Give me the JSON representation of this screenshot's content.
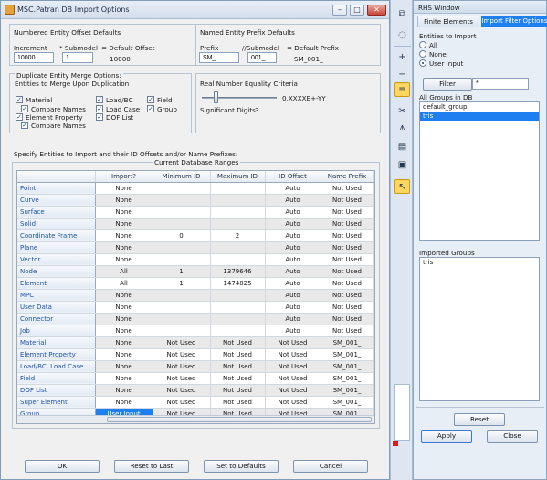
{
  "dialog": {
    "title": "MSC.Patran DB Import Options",
    "min": "–",
    "max": "□",
    "close": "✕"
  },
  "offsets": {
    "legend": "Numbered Entity Offset Defaults",
    "increment_label": "Increment",
    "submodel_label": "* Submodel",
    "default_label": "= Default Offset",
    "increment_value": "10000",
    "submodel_value": "1",
    "default_value": "10000"
  },
  "prefix": {
    "legend": "Named Entity Prefix Defaults",
    "prefix_label": "Prefix",
    "submodel_label": "//Submodel",
    "default_label": "= Default Prefix",
    "prefix_value": "SM_",
    "submodel_value": "001_",
    "default_value": "SM_001_"
  },
  "merge": {
    "legend_line1": "Duplicate Entity Merge Options:",
    "legend_line2": "Entities to Merge Upon Duplication",
    "items": {
      "material": "Material",
      "compare1": "Compare Names",
      "element_property": "Element Property",
      "compare2": "Compare Names",
      "load_bc": "Load/BC",
      "load_case": "Load Case",
      "dof_list": "DOF List",
      "field": "Field",
      "group": "Group"
    }
  },
  "equality": {
    "legend": "Real Number Equality Criteria",
    "format": "0.XXXXE+-YY",
    "digits_label": "Significant Digits",
    "digits_value": "3"
  },
  "table_section": {
    "heading": "Specify Entities to Import and their ID Offsets and/or Name Prefixes:",
    "subheading": "Current Database Ranges",
    "columns": [
      "Import?",
      "Minimum ID",
      "Maximum ID",
      "ID Offset",
      "Name Prefix"
    ],
    "rows": [
      {
        "name": "Point",
        "import": "None",
        "min": "",
        "max": "",
        "offset": "Auto",
        "prefix": "Not Used"
      },
      {
        "name": "Curve",
        "import": "None",
        "min": "",
        "max": "",
        "offset": "Auto",
        "prefix": "Not Used"
      },
      {
        "name": "Surface",
        "import": "None",
        "min": "",
        "max": "",
        "offset": "Auto",
        "prefix": "Not Used"
      },
      {
        "name": "Solid",
        "import": "None",
        "min": "",
        "max": "",
        "offset": "Auto",
        "prefix": "Not Used"
      },
      {
        "name": "Coordinate Frame",
        "import": "None",
        "min": "0",
        "max": "2",
        "offset": "Auto",
        "prefix": "Not Used"
      },
      {
        "name": "Plane",
        "import": "None",
        "min": "",
        "max": "",
        "offset": "Auto",
        "prefix": "Not Used"
      },
      {
        "name": "Vector",
        "import": "None",
        "min": "",
        "max": "",
        "offset": "Auto",
        "prefix": "Not Used"
      },
      {
        "name": "Node",
        "import": "All",
        "min": "1",
        "max": "1379646",
        "offset": "Auto",
        "prefix": "Not Used"
      },
      {
        "name": "Element",
        "import": "All",
        "min": "1",
        "max": "1474825",
        "offset": "Auto",
        "prefix": "Not Used"
      },
      {
        "name": "MPC",
        "import": "None",
        "min": "",
        "max": "",
        "offset": "Auto",
        "prefix": "Not Used"
      },
      {
        "name": "User Data",
        "import": "None",
        "min": "",
        "max": "",
        "offset": "Auto",
        "prefix": "Not Used"
      },
      {
        "name": "Connector",
        "import": "None",
        "min": "",
        "max": "",
        "offset": "Auto",
        "prefix": "Not Used"
      },
      {
        "name": "Job",
        "import": "None",
        "min": "",
        "max": "",
        "offset": "Auto",
        "prefix": "Not Used"
      },
      {
        "name": "Material",
        "import": "None",
        "min": "Not Used",
        "max": "Not Used",
        "offset": "Not Used",
        "prefix": "SM_001_"
      },
      {
        "name": "Element Property",
        "import": "None",
        "min": "Not Used",
        "max": "Not Used",
        "offset": "Not Used",
        "prefix": "SM_001_"
      },
      {
        "name": "Load/BC, Load Case",
        "import": "None",
        "min": "Not Used",
        "max": "Not Used",
        "offset": "Not Used",
        "prefix": "SM_001_"
      },
      {
        "name": "Field",
        "import": "None",
        "min": "Not Used",
        "max": "Not Used",
        "offset": "Not Used",
        "prefix": "SM_001_"
      },
      {
        "name": "DOF List",
        "import": "None",
        "min": "Not Used",
        "max": "Not Used",
        "offset": "Not Used",
        "prefix": "SM_001_"
      },
      {
        "name": "Super Element",
        "import": "None",
        "min": "Not Used",
        "max": "Not Used",
        "offset": "Not Used",
        "prefix": "SM_001_"
      },
      {
        "name": "Group",
        "import": "User Input",
        "min": "Not Used",
        "max": "Not Used",
        "offset": "Not Used",
        "prefix": "SM_001_"
      }
    ]
  },
  "buttons": {
    "ok": "OK",
    "reset_last": "Reset to Last",
    "set_defaults": "Set to Defaults",
    "cancel": "Cancel"
  },
  "rhs": {
    "title": "RHS Window",
    "tab1": "Finite Elements",
    "tab2": "Import Filter Options",
    "entities_label": "Entities to Import",
    "radio_all": "All",
    "radio_none": "None",
    "radio_user": "User Input",
    "filter_button": "Filter",
    "filter_value": "*",
    "all_groups_label": "All Groups in DB",
    "all_groups": [
      "default_group",
      "tris"
    ],
    "imported_label": "Imported Groups",
    "imported_groups": [
      "tris"
    ],
    "reset": "Reset",
    "apply": "Apply",
    "close": "Close"
  },
  "colors": {
    "selection": "#1e7ff0",
    "highlight": "#ffd760"
  }
}
